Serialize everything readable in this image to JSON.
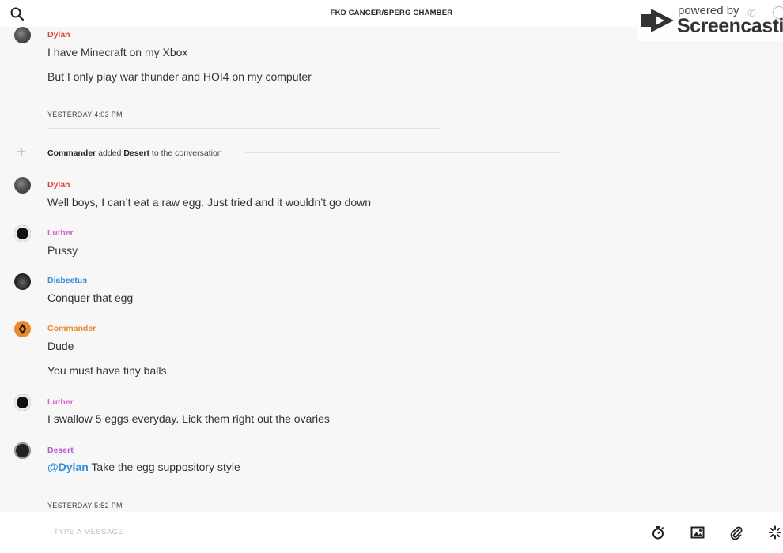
{
  "header": {
    "title": "FKD CANCER/SPERG CHAMBER",
    "search_icon": "search-icon"
  },
  "watermark": {
    "powered_by": "powered by",
    "brand": "Screencastify"
  },
  "messages": {
    "m1": {
      "author": "Dylan",
      "lines": [
        "I have Minecraft on my Xbox",
        "But I only play war thunder and HOI4 on my computer"
      ]
    },
    "ts1": "YESTERDAY 4:03 PM",
    "system": {
      "actor": "Commander",
      "verb": " added ",
      "target": "Desert",
      "rest": " to the conversation"
    },
    "m2": {
      "author": "Dylan",
      "text": "Well boys, I can’t eat a raw egg. Just tried and it wouldn’t go down"
    },
    "m3": {
      "author": "Luther",
      "text": "Pussy"
    },
    "m4": {
      "author": "Diabeetus",
      "text": "Conquer that egg"
    },
    "m5": {
      "author": "Commander",
      "lines": [
        "Dude",
        "You must have tiny balls"
      ]
    },
    "m6": {
      "author": "Luther",
      "text": "I swallow 5 eggs everyday. Lick them right out the ovaries"
    },
    "m7": {
      "author": "Desert",
      "mention": "@Dylan",
      "text": " Take the egg suppository style"
    },
    "ts2": "YESTERDAY 5:52 PM"
  },
  "composer": {
    "placeholder": "TYPE A MESSAGE",
    "tools": [
      "timer-icon",
      "image-icon",
      "paperclip-icon",
      "sparkle-icon"
    ]
  },
  "colors": {
    "dylan": "#d6453a",
    "luther": "#d65fc9",
    "diabeetus": "#3b8fd6",
    "commander": "#e8892b",
    "desert": "#b356d2",
    "mention": "#2f8fd8"
  }
}
